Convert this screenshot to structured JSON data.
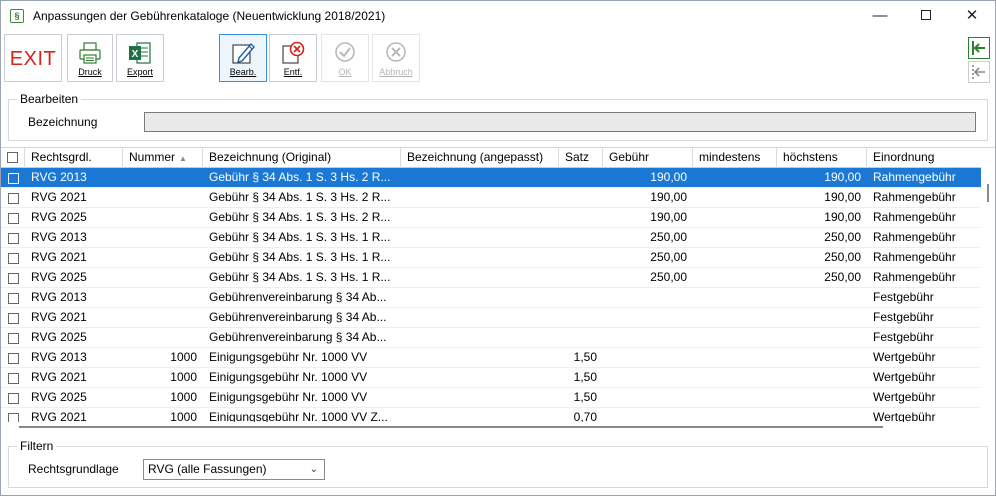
{
  "window": {
    "title": "Anpassungen der Gebührenkataloge (Neuentwicklung 2018/2021)",
    "app_icon": "§"
  },
  "toolbar": {
    "exit": "EXIT",
    "druck": "Druck",
    "export": "Export",
    "bearb": "Bearb.",
    "entf": "Entf.",
    "ok": "OK",
    "abbruch": "Abbruch"
  },
  "bearbeiten": {
    "legend": "Bearbeiten",
    "bezeichnung_label": "Bezeichnung",
    "bezeichnung_value": ""
  },
  "table": {
    "columns": [
      "Rechtsgrdl.",
      "Nummer",
      "Bezeichnung (Original)",
      "Bezeichnung (angepasst)",
      "Satz",
      "Gebühr",
      "mindestens",
      "höchstens",
      "Einordnung"
    ],
    "rows": [
      [
        "RVG 2013",
        "",
        "Gebühr § 34 Abs. 1 S. 3 Hs. 2 R...",
        "",
        "",
        "190,00",
        "",
        "190,00",
        "Rahmengebühr"
      ],
      [
        "RVG 2021",
        "",
        "Gebühr § 34 Abs. 1 S. 3 Hs. 2 R...",
        "",
        "",
        "190,00",
        "",
        "190,00",
        "Rahmengebühr"
      ],
      [
        "RVG 2025",
        "",
        "Gebühr § 34 Abs. 1 S. 3 Hs. 2 R...",
        "",
        "",
        "190,00",
        "",
        "190,00",
        "Rahmengebühr"
      ],
      [
        "RVG 2013",
        "",
        "Gebühr § 34 Abs. 1 S. 3 Hs. 1 R...",
        "",
        "",
        "250,00",
        "",
        "250,00",
        "Rahmengebühr"
      ],
      [
        "RVG 2021",
        "",
        "Gebühr § 34 Abs. 1 S. 3 Hs. 1 R...",
        "",
        "",
        "250,00",
        "",
        "250,00",
        "Rahmengebühr"
      ],
      [
        "RVG 2025",
        "",
        "Gebühr § 34 Abs. 1 S. 3 Hs. 1 R...",
        "",
        "",
        "250,00",
        "",
        "250,00",
        "Rahmengebühr"
      ],
      [
        "RVG 2013",
        "",
        "Gebührenvereinbarung § 34 Ab...",
        "",
        "",
        "",
        "",
        "",
        "Festgebühr"
      ],
      [
        "RVG 2021",
        "",
        "Gebührenvereinbarung § 34 Ab...",
        "",
        "",
        "",
        "",
        "",
        "Festgebühr"
      ],
      [
        "RVG 2025",
        "",
        "Gebührenvereinbarung § 34 Ab...",
        "",
        "",
        "",
        "",
        "",
        "Festgebühr"
      ],
      [
        "RVG 2013",
        "1000",
        "Einigungsgebühr Nr. 1000 VV",
        "",
        "1,50",
        "",
        "",
        "",
        "Wertgebühr"
      ],
      [
        "RVG 2021",
        "1000",
        "Einigungsgebühr Nr. 1000 VV",
        "",
        "1,50",
        "",
        "",
        "",
        "Wertgebühr"
      ],
      [
        "RVG 2025",
        "1000",
        "Einigungsgebühr Nr. 1000 VV",
        "",
        "1,50",
        "",
        "",
        "",
        "Wertgebühr"
      ],
      [
        "RVG 2021",
        "1000",
        "Einigungsgebühr Nr. 1000 VV Z...",
        "",
        "0,70",
        "",
        "",
        "",
        "Wertgebühr"
      ]
    ]
  },
  "filter": {
    "legend": "Filtern",
    "rechtsgrundlage_label": "Rechtsgrundlage",
    "rechtsgrundlage_value": "RVG (alle Fassungen)"
  }
}
